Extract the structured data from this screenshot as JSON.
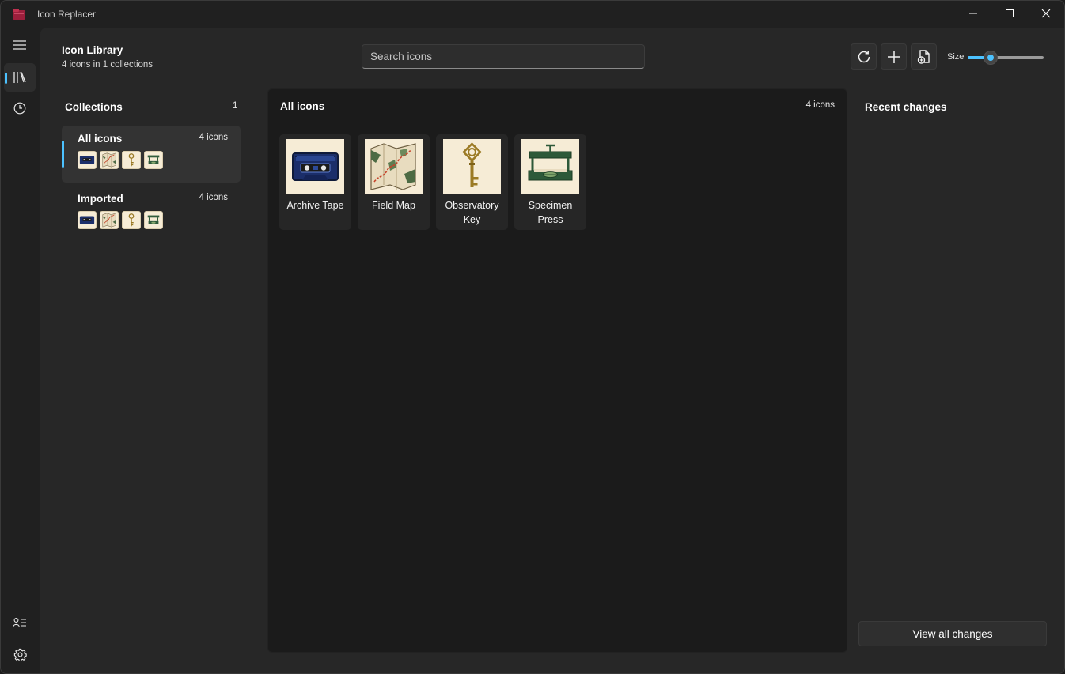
{
  "app": {
    "title": "Icon Replacer"
  },
  "header": {
    "title": "Icon Library",
    "subtitle": "4 icons in 1 collections"
  },
  "search": {
    "placeholder": "Search icons",
    "value": ""
  },
  "toolbar": {
    "refresh_icon": "refresh-icon",
    "add_icon": "plus-icon",
    "import_icon": "import-file-icon",
    "size_label": "Size",
    "size_value_fraction": 0.3
  },
  "collections": {
    "header": "Collections",
    "count": "1",
    "items": [
      {
        "name": "All icons",
        "count": "4 icons",
        "selected": true
      },
      {
        "name": "Imported",
        "count": "4 icons",
        "selected": false
      }
    ]
  },
  "grid": {
    "title": "All icons",
    "count": "4 icons",
    "icons": [
      {
        "label": "Archive Tape",
        "icon": "cassette-tape-icon"
      },
      {
        "label": "Field Map",
        "icon": "folded-map-icon"
      },
      {
        "label": "Observatory Key",
        "icon": "key-icon"
      },
      {
        "label": "Specimen Press",
        "icon": "specimen-press-icon"
      }
    ]
  },
  "recent": {
    "title": "Recent changes",
    "view_all_label": "View all changes"
  },
  "colors": {
    "accent": "#4cc2ff",
    "icon_background": "#f6ecd6"
  }
}
